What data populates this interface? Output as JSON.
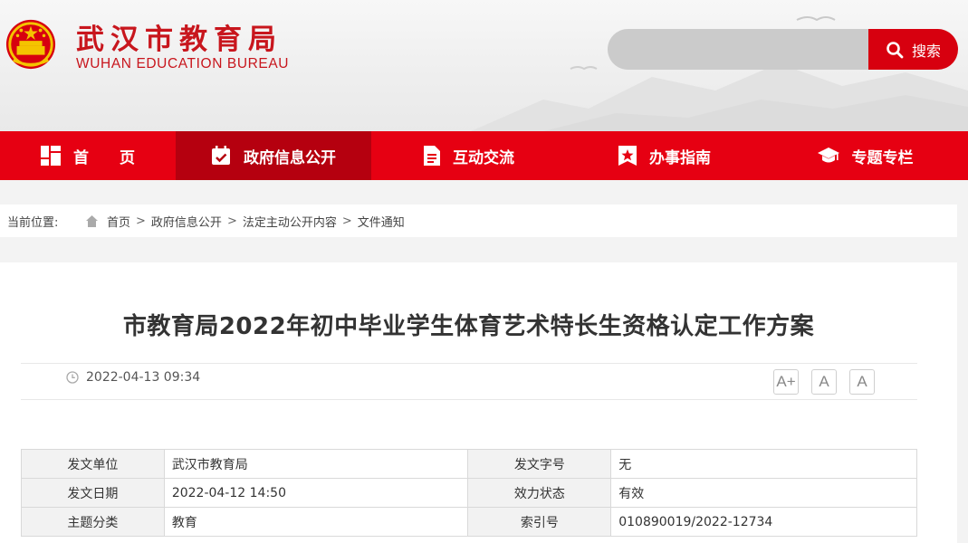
{
  "brand": {
    "name_cn": "武汉市教育局",
    "name_en": "WUHAN EDUCATION BUREAU",
    "color": "#c8161d"
  },
  "search": {
    "placeholder": "",
    "button_label": "搜索"
  },
  "nav": {
    "items": [
      {
        "label": "首　　页",
        "icon": "grid-icon"
      },
      {
        "label": "政府信息公开",
        "icon": "calendar-check-icon",
        "active": true
      },
      {
        "label": "互动交流",
        "icon": "document-icon"
      },
      {
        "label": "办事指南",
        "icon": "star-bookmark-icon"
      },
      {
        "label": "专题专栏",
        "icon": "graduation-cap-icon"
      }
    ],
    "color": "#e60012",
    "active_color": "#b5000f"
  },
  "breadcrumb": {
    "label": "当前位置:",
    "items": [
      "首页",
      "政府信息公开",
      "法定主动公开内容",
      "文件通知"
    ],
    "separator": ">"
  },
  "article": {
    "title": "市教育局2022年初中毕业学生体育艺术特长生资格认定工作方案",
    "datetime": "2022-04-13 09:34",
    "font_buttons": [
      "A+",
      "A",
      "A"
    ]
  },
  "info_table": {
    "rows": [
      [
        {
          "k": "发文单位",
          "v": "武汉市教育局"
        },
        {
          "k": "发文字号",
          "v": "无"
        }
      ],
      [
        {
          "k": "发文日期",
          "v": "2022-04-12 14:50"
        },
        {
          "k": "效力状态",
          "v": "有效"
        }
      ],
      [
        {
          "k": "主题分类",
          "v": "教育"
        },
        {
          "k": "索引号",
          "v": "010890019/2022-12734"
        }
      ]
    ]
  }
}
